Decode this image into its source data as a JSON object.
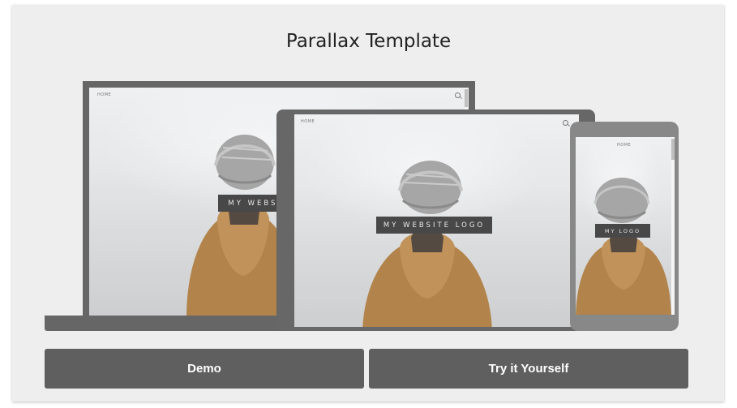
{
  "title": "Parallax Template",
  "laptop": {
    "nav_home": "HOME",
    "logo_text": "MY WEBSITE LOGO"
  },
  "tablet": {
    "nav_home": "HOME",
    "logo_text": "MY WEBSITE LOGO"
  },
  "phone": {
    "nav_home": "HOME",
    "logo_text": "MY LOGO"
  },
  "buttons": {
    "demo": "Demo",
    "try": "Try it Yourself"
  },
  "icons": {
    "search": "search-icon"
  },
  "colors": {
    "device": "#666666",
    "button": "#5f5f5f",
    "card": "#eeeeee",
    "logo_box": "#2f2f2f"
  }
}
